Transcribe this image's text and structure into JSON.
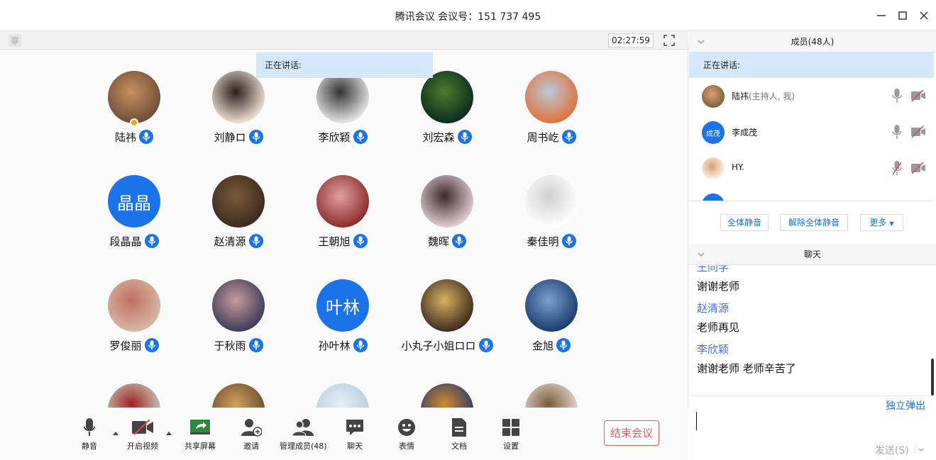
{
  "window": {
    "title": "腾讯会议 会议号：151 737 495"
  },
  "meeting": {
    "timer": "02:27:59",
    "speaking_label": "正在讲话:"
  },
  "participants": [
    {
      "name": "陆祎",
      "initials": "",
      "colors": [
        "#6b4e3a",
        "#c98f5c"
      ],
      "host": true
    },
    {
      "name": "刘静ロ",
      "initials": "",
      "colors": [
        "#f2e4d6",
        "#2c1f1a"
      ]
    },
    {
      "name": "李欣颖",
      "initials": "",
      "colors": [
        "#e9e9e9",
        "#333333"
      ]
    },
    {
      "name": "刘宏森",
      "initials": "",
      "colors": [
        "#0b2a1e",
        "#4d7a2e"
      ]
    },
    {
      "name": "周书屹",
      "initials": "",
      "colors": [
        "#e0713a",
        "#b9c9d8"
      ]
    },
    {
      "name": "段晶晶",
      "initials": "晶晶",
      "colors": [
        "#1a73e8",
        "#1a73e8"
      ]
    },
    {
      "name": "赵清源",
      "initials": "",
      "colors": [
        "#3a2a1e",
        "#7a5a3a"
      ]
    },
    {
      "name": "王朝旭",
      "initials": "",
      "colors": [
        "#8a2a2a",
        "#e0a0a0"
      ]
    },
    {
      "name": "魏晖",
      "initials": "",
      "colors": [
        "#e5d0d8",
        "#3a2a2a"
      ]
    },
    {
      "name": "秦佳明",
      "initials": "",
      "colors": [
        "#ffffff",
        "#d0d0d0"
      ]
    },
    {
      "name": "罗俊丽",
      "initials": "",
      "colors": [
        "#d8b8a8",
        "#c07060"
      ]
    },
    {
      "name": "于秋雨",
      "initials": "",
      "colors": [
        "#3a3a5a",
        "#c89a9a"
      ]
    },
    {
      "name": "孙叶林",
      "initials": "叶林",
      "colors": [
        "#1a73e8",
        "#1a73e8"
      ]
    },
    {
      "name": "小丸子小姐ロロ",
      "initials": "",
      "colors": [
        "#3a2a1e",
        "#d8b060"
      ]
    },
    {
      "name": "金旭",
      "initials": "",
      "colors": [
        "#1a3a6a",
        "#7aa0d0"
      ]
    },
    {
      "name": "",
      "initials": "",
      "colors": [
        "#c8d0c0",
        "#a02020"
      ]
    },
    {
      "name": "",
      "initials": "",
      "colors": [
        "#6a4a2a",
        "#d0a060"
      ]
    },
    {
      "name": "",
      "initials": "",
      "colors": [
        "#b8cce0",
        "#e8eef4"
      ]
    },
    {
      "name": "",
      "initials": "",
      "colors": [
        "#2a3a6a",
        "#d08a2a"
      ]
    },
    {
      "name": "",
      "initials": "",
      "colors": [
        "#e8e0d8",
        "#7a5a3a"
      ]
    }
  ],
  "toolbar": {
    "mute": "静音",
    "video": "开启视频",
    "share": "共享屏幕",
    "invite": "邀请",
    "manage": "管理成员(48)",
    "chat": "聊天",
    "emoji": "表情",
    "docs": "文档",
    "settings": "设置",
    "end": "结束会议"
  },
  "members": {
    "header": "成员(48人)",
    "speaking_label": "正在讲话:",
    "list": [
      {
        "name": "陆祎",
        "sub": "(主持人, 我)",
        "initials": "",
        "color": "#7a5a3a",
        "mic": "on",
        "cam": "off"
      },
      {
        "name": "李成茂",
        "sub": "",
        "initials": "成茂",
        "color": "#1a73e8",
        "mic": "on",
        "cam": "off"
      },
      {
        "name": "HY.",
        "sub": "",
        "initials": "",
        "color": "#ffffff",
        "mic": "off",
        "cam": "off"
      }
    ],
    "mute_all": "全体静音",
    "unmute_all": "解除全体静音",
    "more": "更多"
  },
  "chat": {
    "header": "聊天",
    "messages": [
      {
        "sender": "王同学",
        "text": "谢谢老师"
      },
      {
        "sender": "赵清源",
        "text": "老师再见"
      },
      {
        "sender": "李欣颖",
        "text": "谢谢老师 老师辛苦了"
      }
    ],
    "popout": "独立弹出",
    "send": "发送(S)"
  }
}
